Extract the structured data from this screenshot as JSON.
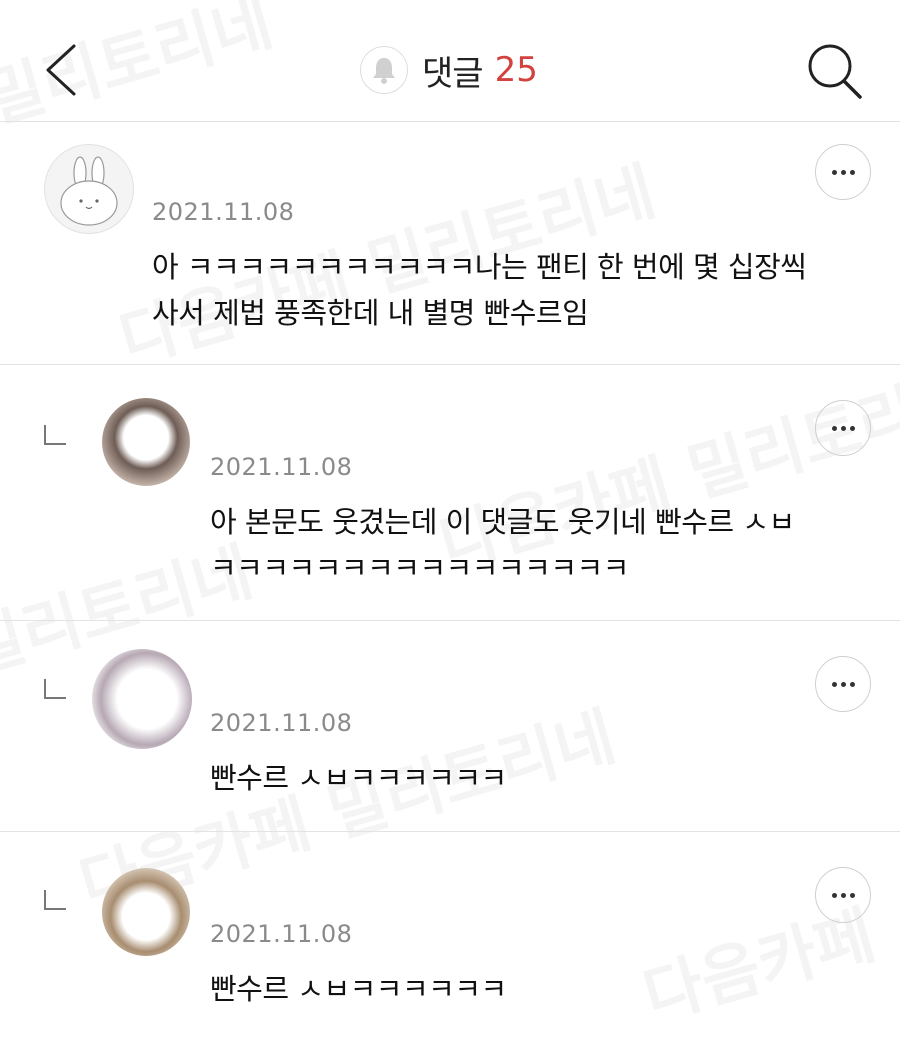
{
  "header": {
    "title": "댓글",
    "count": "25",
    "back_icon": "chevron-left-icon",
    "search_icon": "search-icon",
    "bell_icon": "bell-icon"
  },
  "comments": [
    {
      "date": "2021.11.08",
      "line1": "아 ㅋㅋㅋㅋㅋㅋㅋㅋㅋㅋㅋ나는 팬티 한 번에 몇 십장씩",
      "line2": "사서 제법 풍족한데 내 별명 빤수르임"
    },
    {
      "date": "2021.11.08",
      "line1": "아 본문도 웃겼는데 이 댓글도 웃기네 빤수르 ㅅㅂ",
      "line2": "ㅋㅋㅋㅋㅋㅋㅋㅋㅋㅋㅋㅋㅋㅋㅋㅋ"
    },
    {
      "date": "2021.11.08",
      "line1": "빤수르 ㅅㅂㅋㅋㅋㅋㅋㅋ"
    },
    {
      "date": "2021.11.08",
      "line1": "빤수르 ㅅㅂㅋㅋㅋㅋㅋㅋ"
    }
  ],
  "watermarks": [
    "밀리토리네",
    "다음카페 밀리토리네",
    "다음카페 밀리토리네",
    "밀리토리네",
    "다음카페 밀리토리네",
    "다음카페",
    "토리네"
  ],
  "colors": {
    "accent": "#d2423e",
    "date": "#8a8a8a",
    "divider": "#e3e3e3"
  }
}
